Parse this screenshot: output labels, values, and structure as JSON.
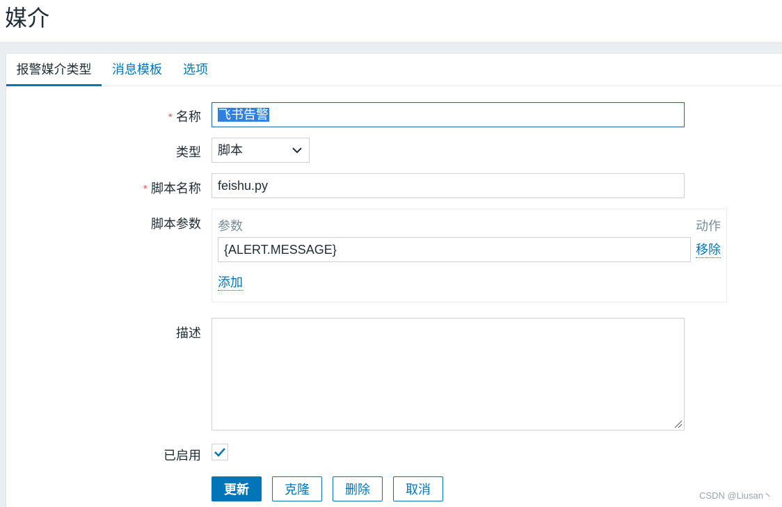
{
  "page": {
    "title": "媒介"
  },
  "tabs": [
    {
      "label": "报警媒介类型",
      "active": true
    },
    {
      "label": "消息模板",
      "active": false
    },
    {
      "label": "选项",
      "active": false
    }
  ],
  "form": {
    "name": {
      "label": "名称",
      "required_mark": "*",
      "value": "飞书告警"
    },
    "type": {
      "label": "类型",
      "value": "脚本"
    },
    "script_name": {
      "label": "脚本名称",
      "required_mark": "*",
      "value": "feishu.py"
    },
    "script_params": {
      "label": "脚本参数",
      "column_param": "参数",
      "column_action": "动作",
      "rows": [
        {
          "value": "{ALERT.MESSAGE}",
          "action": "移除"
        }
      ],
      "add_label": "添加"
    },
    "description": {
      "label": "描述",
      "value": ""
    },
    "enabled": {
      "label": "已启用",
      "checked": true
    }
  },
  "buttons": {
    "update": "更新",
    "clone": "克隆",
    "delete": "删除",
    "cancel": "取消"
  },
  "watermark": "CSDN @Liusan丶",
  "colors": {
    "accent": "#0275b8",
    "required": "#e45959",
    "selection": "#2f80e1"
  }
}
